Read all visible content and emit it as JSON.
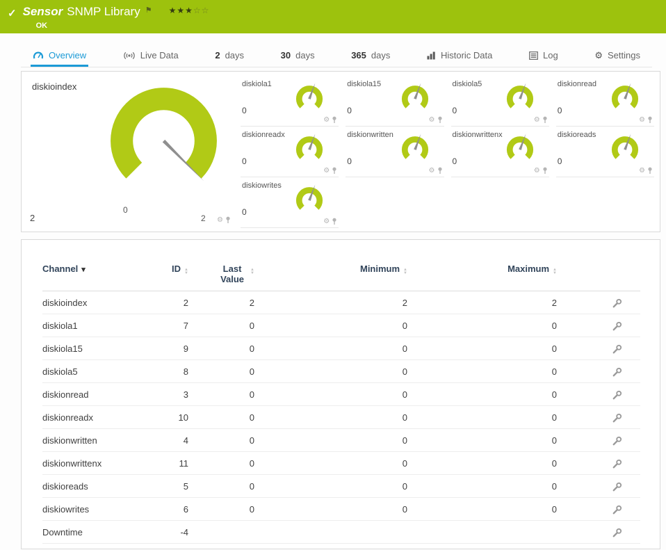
{
  "colors": {
    "header_green": "#9dc20d",
    "gauge_green": "#b1ca16",
    "accent_blue": "#1b9ad6"
  },
  "icons": {
    "check": "✓",
    "flag": "⚑",
    "gear": "⚙",
    "caret_down": "▾",
    "sort_asc": "▲",
    "sort_desc": "▼"
  },
  "header": {
    "type_label": "Sensor",
    "title": "SNMP Library",
    "status": "OK",
    "stars_filled": "★★★",
    "stars_empty": "☆☆"
  },
  "tabs": [
    {
      "label": "Overview"
    },
    {
      "label": "Live Data"
    },
    {
      "value": "2",
      "unit": "days"
    },
    {
      "value": "30",
      "unit": "days"
    },
    {
      "value": "365",
      "unit": "days"
    },
    {
      "label": "Historic Data"
    },
    {
      "label": "Log"
    },
    {
      "label": "Settings"
    }
  ],
  "gauge_panel": {
    "main": {
      "label": "diskioindex",
      "value": "2",
      "scale_min": "0",
      "scale_max": "2"
    },
    "small": [
      {
        "label": "diskiola1",
        "value": "0"
      },
      {
        "label": "diskiola15",
        "value": "0"
      },
      {
        "label": "diskiola5",
        "value": "0"
      },
      {
        "label": "diskionread",
        "value": "0"
      },
      {
        "label": "diskionreadx",
        "value": "0"
      },
      {
        "label": "diskionwritten",
        "value": "0"
      },
      {
        "label": "diskionwrittenx",
        "value": "0"
      },
      {
        "label": "diskioreads",
        "value": "0"
      },
      {
        "label": "diskiowrites",
        "value": "0"
      }
    ]
  },
  "table": {
    "headers": {
      "channel": "Channel",
      "id": "ID",
      "last_value": "Last Value",
      "minimum": "Minimum",
      "maximum": "Maximum"
    },
    "rows": [
      {
        "channel": "diskioindex",
        "id": "2",
        "last_value": "2",
        "minimum": "2",
        "maximum": "2"
      },
      {
        "channel": "diskiola1",
        "id": "7",
        "last_value": "0",
        "minimum": "0",
        "maximum": "0"
      },
      {
        "channel": "diskiola15",
        "id": "9",
        "last_value": "0",
        "minimum": "0",
        "maximum": "0"
      },
      {
        "channel": "diskiola5",
        "id": "8",
        "last_value": "0",
        "minimum": "0",
        "maximum": "0"
      },
      {
        "channel": "diskionread",
        "id": "3",
        "last_value": "0",
        "minimum": "0",
        "maximum": "0"
      },
      {
        "channel": "diskionreadx",
        "id": "10",
        "last_value": "0",
        "minimum": "0",
        "maximum": "0"
      },
      {
        "channel": "diskionwritten",
        "id": "4",
        "last_value": "0",
        "minimum": "0",
        "maximum": "0"
      },
      {
        "channel": "diskionwrittenx",
        "id": "11",
        "last_value": "0",
        "minimum": "0",
        "maximum": "0"
      },
      {
        "channel": "diskioreads",
        "id": "5",
        "last_value": "0",
        "minimum": "0",
        "maximum": "0"
      },
      {
        "channel": "diskiowrites",
        "id": "6",
        "last_value": "0",
        "minimum": "0",
        "maximum": "0"
      },
      {
        "channel": "Downtime",
        "id": "-4",
        "last_value": "",
        "minimum": "",
        "maximum": ""
      }
    ]
  }
}
